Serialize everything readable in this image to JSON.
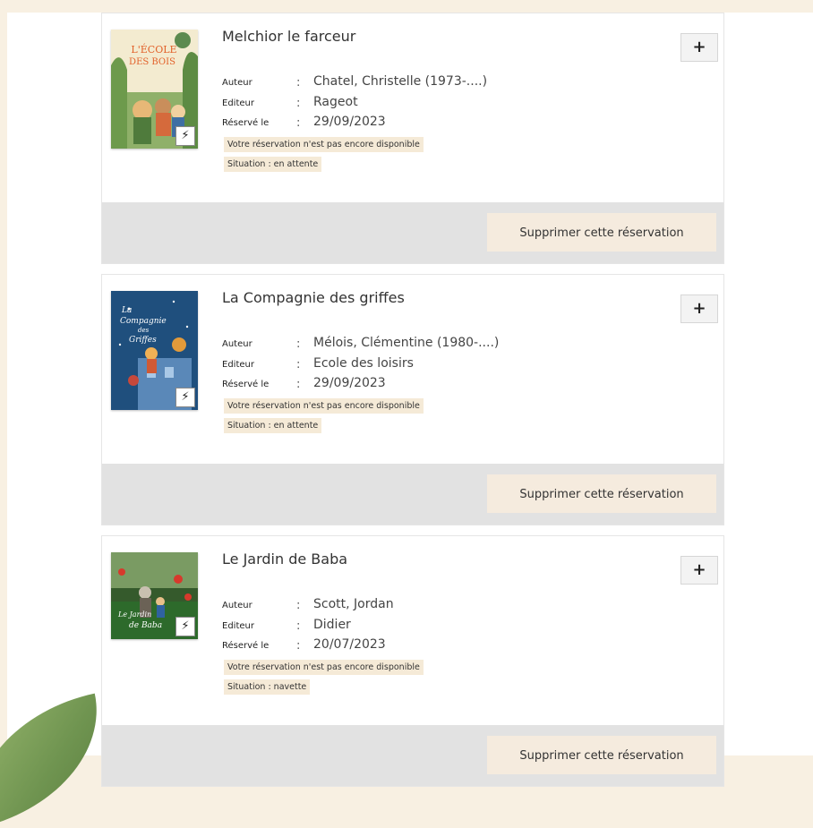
{
  "reservations": [
    {
      "title": "Melchior le farceur",
      "cover_text": [
        "L'ÉCOLE",
        "DES BOIS"
      ],
      "details_label": "+",
      "author_label": "Auteur",
      "author": "Chatel, Christelle (1973-....)",
      "publisher_label": "Editeur",
      "publisher": "Rageot",
      "reserved_label": "Réservé le",
      "reserved_date": "29/09/2023",
      "availability": "Votre réservation n'est pas encore disponible",
      "status": "Situation : en attente",
      "delete_label": "Supprimer cette réservation"
    },
    {
      "title": "La Compagnie des griffes",
      "cover_text": [
        "La",
        "Compagnie",
        "des",
        "Griffes"
      ],
      "details_label": "+",
      "author_label": "Auteur",
      "author": "Mélois, Clémentine (1980-....)",
      "publisher_label": "Editeur",
      "publisher": "Ecole des loisirs",
      "reserved_label": "Réservé le",
      "reserved_date": "29/09/2023",
      "availability": "Votre réservation n'est pas encore disponible",
      "status": "Situation : en attente",
      "delete_label": "Supprimer cette réservation"
    },
    {
      "title": "Le Jardin de Baba",
      "cover_text": [
        "Le Jardin",
        "de Baba"
      ],
      "details_label": "+",
      "author_label": "Auteur",
      "author": "Scott, Jordan",
      "publisher_label": "Editeur",
      "publisher": "Didier",
      "reserved_label": "Réservé le",
      "reserved_date": "20/07/2023",
      "availability": "Votre réservation n'est pas encore disponible",
      "status": "Situation : navette",
      "delete_label": "Supprimer cette réservation"
    }
  ],
  "icons": {
    "flash": "⚡",
    "flash_icon_name": "lightning-icon",
    "details_icon_name": "plus-icon"
  },
  "colors": {
    "page_background": "#f8f0e2",
    "badge_background": "#f5ead7",
    "footer_background": "#e2e2e2",
    "delete_button_background": "#f5ebde"
  }
}
